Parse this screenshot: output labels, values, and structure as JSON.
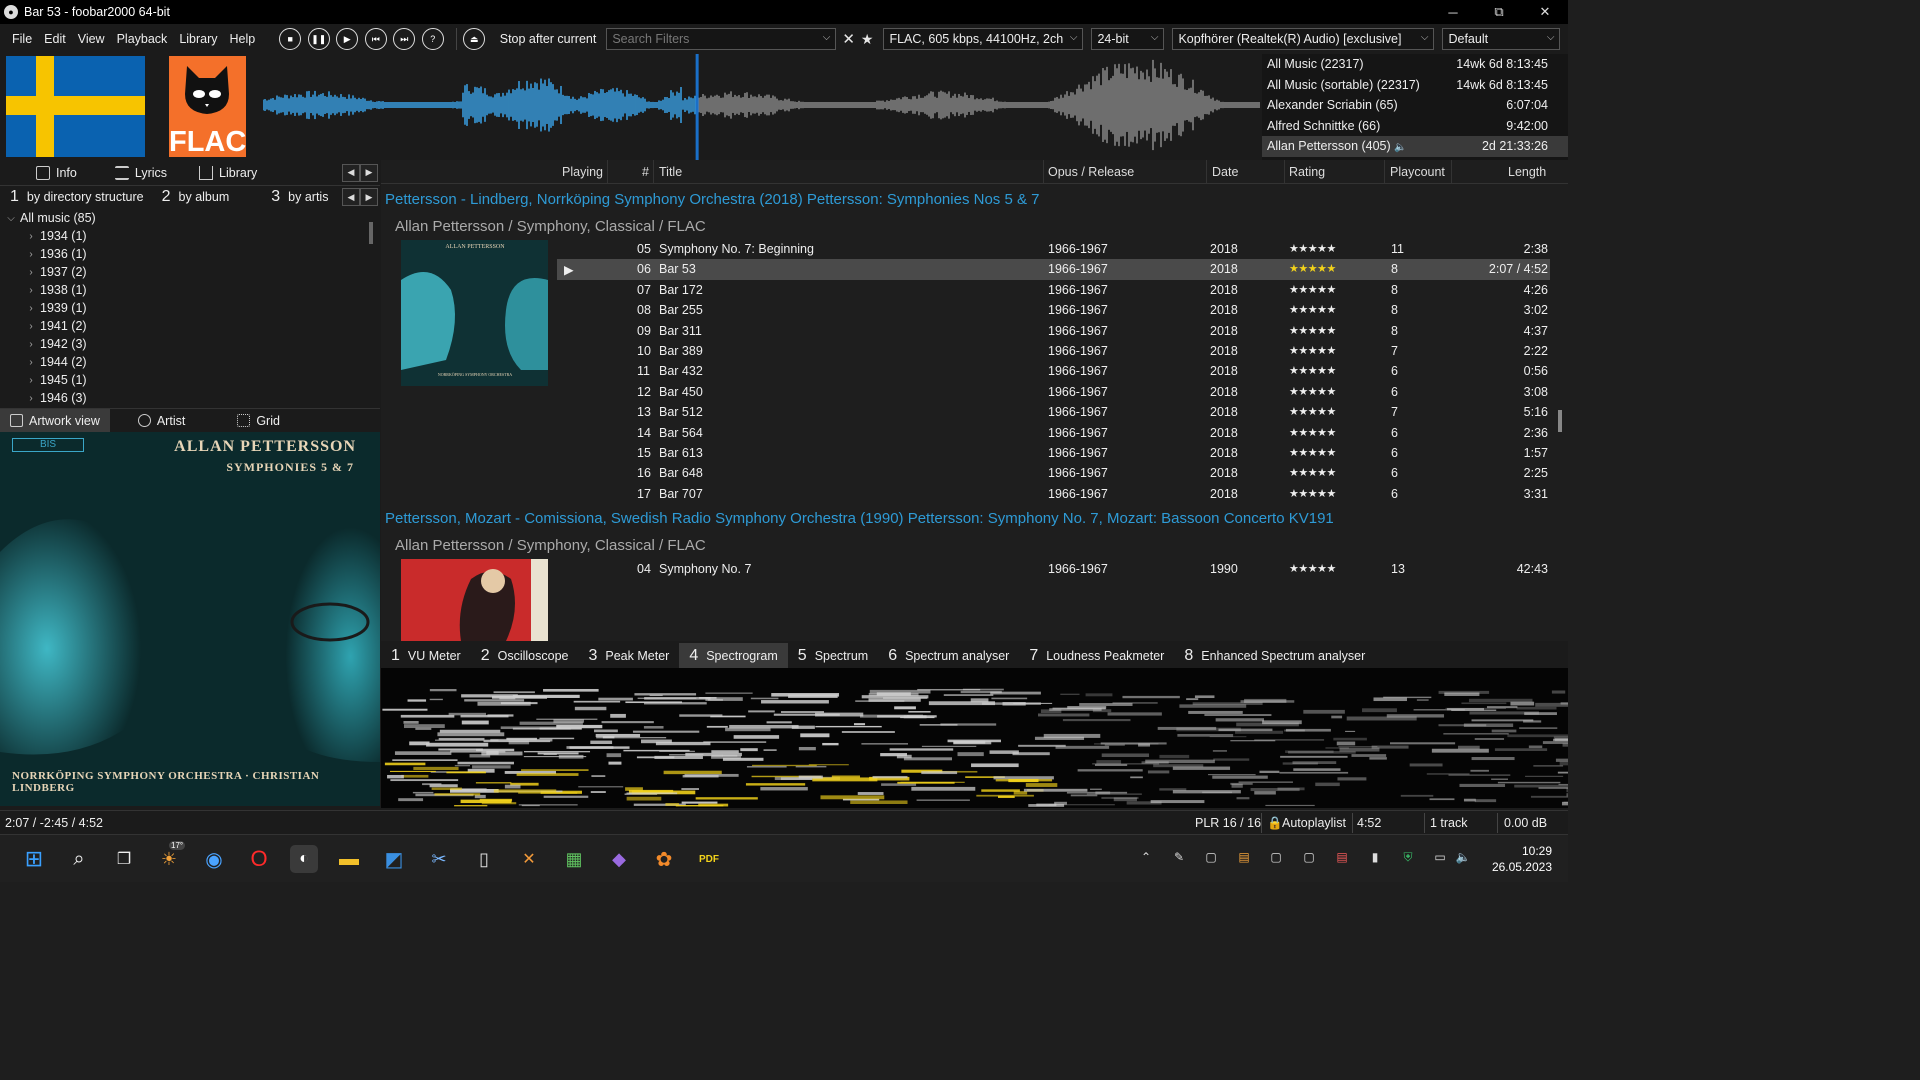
{
  "window": {
    "title": "Bar 53 - foobar2000 64-bit",
    "minimize": "─",
    "maximize": "⧉",
    "close": "✕"
  },
  "menu": [
    "File",
    "Edit",
    "View",
    "Playback",
    "Library",
    "Help"
  ],
  "transport": {
    "stop_after": "Stop after current",
    "search_placeholder": "Search Filters",
    "format": "FLAC, 605 kbps, 44100Hz, 2ch",
    "bitdepth": "24-bit",
    "device": "Kopfhörer (Realtek(R) Audio) [exclusive]",
    "preset": "Default"
  },
  "logo_text": "FLAC",
  "queries": [
    {
      "name": "All Music (22317)",
      "time": "14wk 6d 8:13:45"
    },
    {
      "name": "All Music (sortable) (22317)",
      "time": "14wk 6d 8:13:45"
    },
    {
      "name": "Alexander Scriabin (65)",
      "time": "6:07:04"
    },
    {
      "name": "Alfred Schnittke (66)",
      "time": "9:42:00"
    },
    {
      "name": "Allan Pettersson (405)",
      "time": "2d 21:33:26"
    }
  ],
  "left_tabs": [
    "Info",
    "Lyrics",
    "Library"
  ],
  "view_tabs": [
    {
      "n": "1",
      "label": "by directory structure"
    },
    {
      "n": "2",
      "label": "by album"
    },
    {
      "n": "3",
      "label": "by artis"
    }
  ],
  "tree": {
    "root": "All music (85)",
    "items": [
      "1934 (1)",
      "1936 (1)",
      "1937 (2)",
      "1938 (1)",
      "1939 (1)",
      "1941 (2)",
      "1942 (3)",
      "1944 (2)",
      "1945 (1)",
      "1946 (3)"
    ]
  },
  "art_tabs": [
    "Artwork view",
    "Artist",
    "Grid"
  ],
  "cover": {
    "label": "BIS",
    "title": "ALLAN PETTERSSON",
    "subtitle": "SYMPHONIES 5 & 7",
    "footer": "NORRKÖPING SYMPHONY ORCHESTRA · CHRISTIAN LINDBERG"
  },
  "columns": {
    "playing": "Playing",
    "num": "#",
    "title": "Title",
    "opus": "Opus / Release",
    "date": "Date",
    "rating": "Rating",
    "playcount": "Playcount",
    "length": "Length"
  },
  "groups": [
    {
      "header": "Pettersson - Lindberg, Norrköping Symphony Orchestra (2018) Pettersson: Symphonies Nos 5 & 7",
      "sub": "Allan Pettersson / Symphony, Classical / FLAC",
      "tracks": [
        {
          "n": "05",
          "title": "Symphony No. 7: Beginning",
          "opus": "1966-1967",
          "date": "2018",
          "rating": "★★★★★",
          "count": "11",
          "len": "2:38"
        },
        {
          "n": "06",
          "title": "Bar 53",
          "opus": "1966-1967",
          "date": "2018",
          "rating": "★★★★★",
          "count": "8",
          "len": "2:07 / 4:52",
          "current": true,
          "play": "▶"
        },
        {
          "n": "07",
          "title": "Bar 172",
          "opus": "1966-1967",
          "date": "2018",
          "rating": "★★★★★",
          "count": "8",
          "len": "4:26"
        },
        {
          "n": "08",
          "title": "Bar 255",
          "opus": "1966-1967",
          "date": "2018",
          "rating": "★★★★★",
          "count": "8",
          "len": "3:02"
        },
        {
          "n": "09",
          "title": "Bar 311",
          "opus": "1966-1967",
          "date": "2018",
          "rating": "★★★★★",
          "count": "8",
          "len": "4:37"
        },
        {
          "n": "10",
          "title": "Bar 389",
          "opus": "1966-1967",
          "date": "2018",
          "rating": "★★★★★",
          "count": "7",
          "len": "2:22"
        },
        {
          "n": "11",
          "title": "Bar 432",
          "opus": "1966-1967",
          "date": "2018",
          "rating": "★★★★★",
          "count": "6",
          "len": "0:56"
        },
        {
          "n": "12",
          "title": "Bar 450",
          "opus": "1966-1967",
          "date": "2018",
          "rating": "★★★★★",
          "count": "6",
          "len": "3:08"
        },
        {
          "n": "13",
          "title": "Bar 512",
          "opus": "1966-1967",
          "date": "2018",
          "rating": "★★★★★",
          "count": "7",
          "len": "5:16"
        },
        {
          "n": "14",
          "title": "Bar 564",
          "opus": "1966-1967",
          "date": "2018",
          "rating": "★★★★★",
          "count": "6",
          "len": "2:36"
        },
        {
          "n": "15",
          "title": "Bar 613",
          "opus": "1966-1967",
          "date": "2018",
          "rating": "★★★★★",
          "count": "6",
          "len": "1:57"
        },
        {
          "n": "16",
          "title": "Bar 648",
          "opus": "1966-1967",
          "date": "2018",
          "rating": "★★★★★",
          "count": "6",
          "len": "2:25"
        },
        {
          "n": "17",
          "title": "Bar 707",
          "opus": "1966-1967",
          "date": "2018",
          "rating": "★★★★★",
          "count": "6",
          "len": "3:31"
        }
      ]
    },
    {
      "header": "Pettersson, Mozart - Comissiona, Swedish Radio Symphony Orchestra (1990) Pettersson: Symphony No. 7, Mozart: Bassoon Concerto KV191",
      "sub": "Allan Pettersson / Symphony, Classical / FLAC",
      "tracks": [
        {
          "n": "04",
          "title": "Symphony No. 7",
          "opus": "1966-1967",
          "date": "1990",
          "rating": "★★★★★",
          "count": "13",
          "len": "42:43"
        }
      ]
    }
  ],
  "vis_tabs": [
    {
      "n": "1",
      "label": "VU Meter"
    },
    {
      "n": "2",
      "label": "Oscilloscope"
    },
    {
      "n": "3",
      "label": "Peak Meter"
    },
    {
      "n": "4",
      "label": "Spectrogram"
    },
    {
      "n": "5",
      "label": "Spectrum"
    },
    {
      "n": "6",
      "label": "Spectrum analyser"
    },
    {
      "n": "7",
      "label": "Loudness Peakmeter"
    },
    {
      "n": "8",
      "label": "Enhanced Spectrum analyser"
    }
  ],
  "status": {
    "time": "2:07 / -2:45 / 4:52",
    "plr": "PLR 16 / 16",
    "autoplaylist": "Autoplaylist",
    "duration": "4:52",
    "tracks": "1 track",
    "gain": "0.00 dB"
  },
  "taskbar": {
    "weather": "17°",
    "time": "10:29",
    "date": "26.05.2023"
  },
  "playback_progress": 0.435,
  "colors": {
    "accent": "#2e9bd6",
    "star_current": "#f2d21b",
    "selection": "#4a4a4a"
  }
}
